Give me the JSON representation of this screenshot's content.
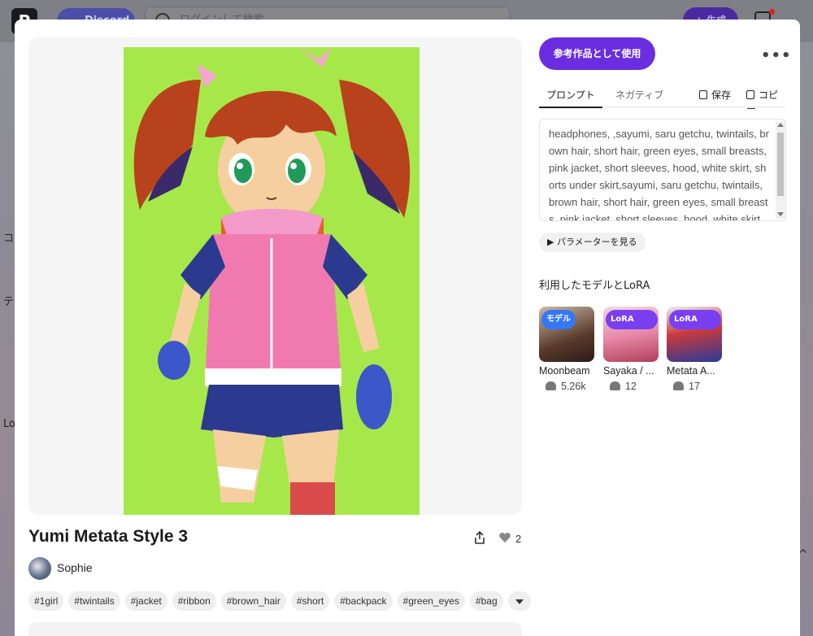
{
  "background": {
    "logo": "P",
    "discord_label": "Discord",
    "search_placeholder": "ログインして検索",
    "generate_label": "+ 生成",
    "side_texts": [
      "コ",
      "テ",
      "Lo"
    ]
  },
  "post": {
    "title": "Yumi Metata Style 3",
    "likes": "2",
    "author": "Sophie",
    "tags": [
      "#1girl",
      "#twintails",
      "#jacket",
      "#ribbon",
      "#brown_hair",
      "#short",
      "#backpack",
      "#green_eyes",
      "#bag"
    ]
  },
  "panel": {
    "use_reference_label": "参考作品として使用",
    "more_label": "•••",
    "tabs": [
      "プロンプト",
      "ネガティブ"
    ],
    "save_label": "保存",
    "copy_label": "コピー",
    "prompt_text": "headphones, ,sayumi, saru getchu, twintails, brown hair, short hair, green eyes, small breasts, pink jacket, short sleeves, hood, white skirt, shorts under skirt,sayumi, saru getchu, twintails, brown hair, short hair, green eyes, small breasts, pink jacket, short sleeves, hood, white skirt, shorts under skirt",
    "params_label": "▶ パラメーターを見る",
    "models_title": "利用したモデルとLoRA",
    "models": [
      {
        "name": "Moonbeam",
        "likes": "5.26k",
        "badge": "モデル"
      },
      {
        "name": "Sayaka / ...",
        "likes": "12",
        "badge": "LoRA"
      },
      {
        "name": "Metata A...",
        "likes": "17",
        "badge": "LoRA"
      }
    ]
  },
  "colors": {
    "accent": "#6a2ee0",
    "art_background": "#a6e84a",
    "jacket": "#f07ab0",
    "hair": "#b8421c",
    "shorts": "#2b3a8f"
  }
}
